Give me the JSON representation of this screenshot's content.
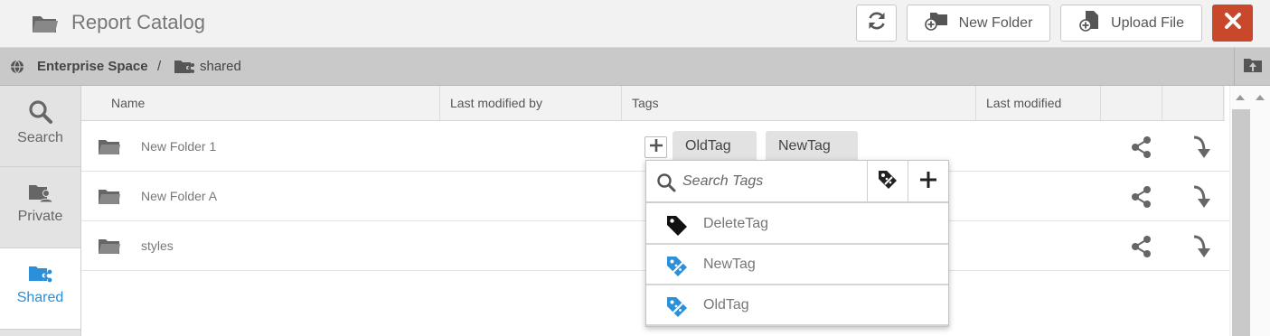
{
  "header": {
    "title": "Report Catalog",
    "new_folder_label": "New Folder",
    "upload_file_label": "Upload File"
  },
  "breadcrumb": {
    "root": "Enterprise Space",
    "separator": "/",
    "current": "shared"
  },
  "sidebar": {
    "items": [
      {
        "label": "Search",
        "icon": "search-icon",
        "active": false
      },
      {
        "label": "Private",
        "icon": "private-folder-icon",
        "active": false
      },
      {
        "label": "Shared",
        "icon": "shared-folder-icon",
        "active": true
      }
    ]
  },
  "table": {
    "columns": [
      "Name",
      "Last modified by",
      "Tags",
      "Last modified"
    ],
    "rows": [
      {
        "name": "New Folder 1",
        "tags": [
          "OldTag",
          "NewTag"
        ]
      },
      {
        "name": "New Folder A",
        "tags": []
      },
      {
        "name": "styles",
        "tags": []
      }
    ]
  },
  "tag_popup": {
    "search_placeholder": "Search Tags",
    "tags": [
      {
        "label": "DeleteTag",
        "icon": "tag-icon",
        "color": "#111111"
      },
      {
        "label": "NewTag",
        "icon": "percent-tag-icon",
        "color": "#2b8fd9"
      },
      {
        "label": "OldTag",
        "icon": "percent-tag-icon",
        "color": "#2b8fd9"
      }
    ]
  },
  "colors": {
    "accent": "#2b8fd9",
    "close_button": "#c9472b"
  }
}
